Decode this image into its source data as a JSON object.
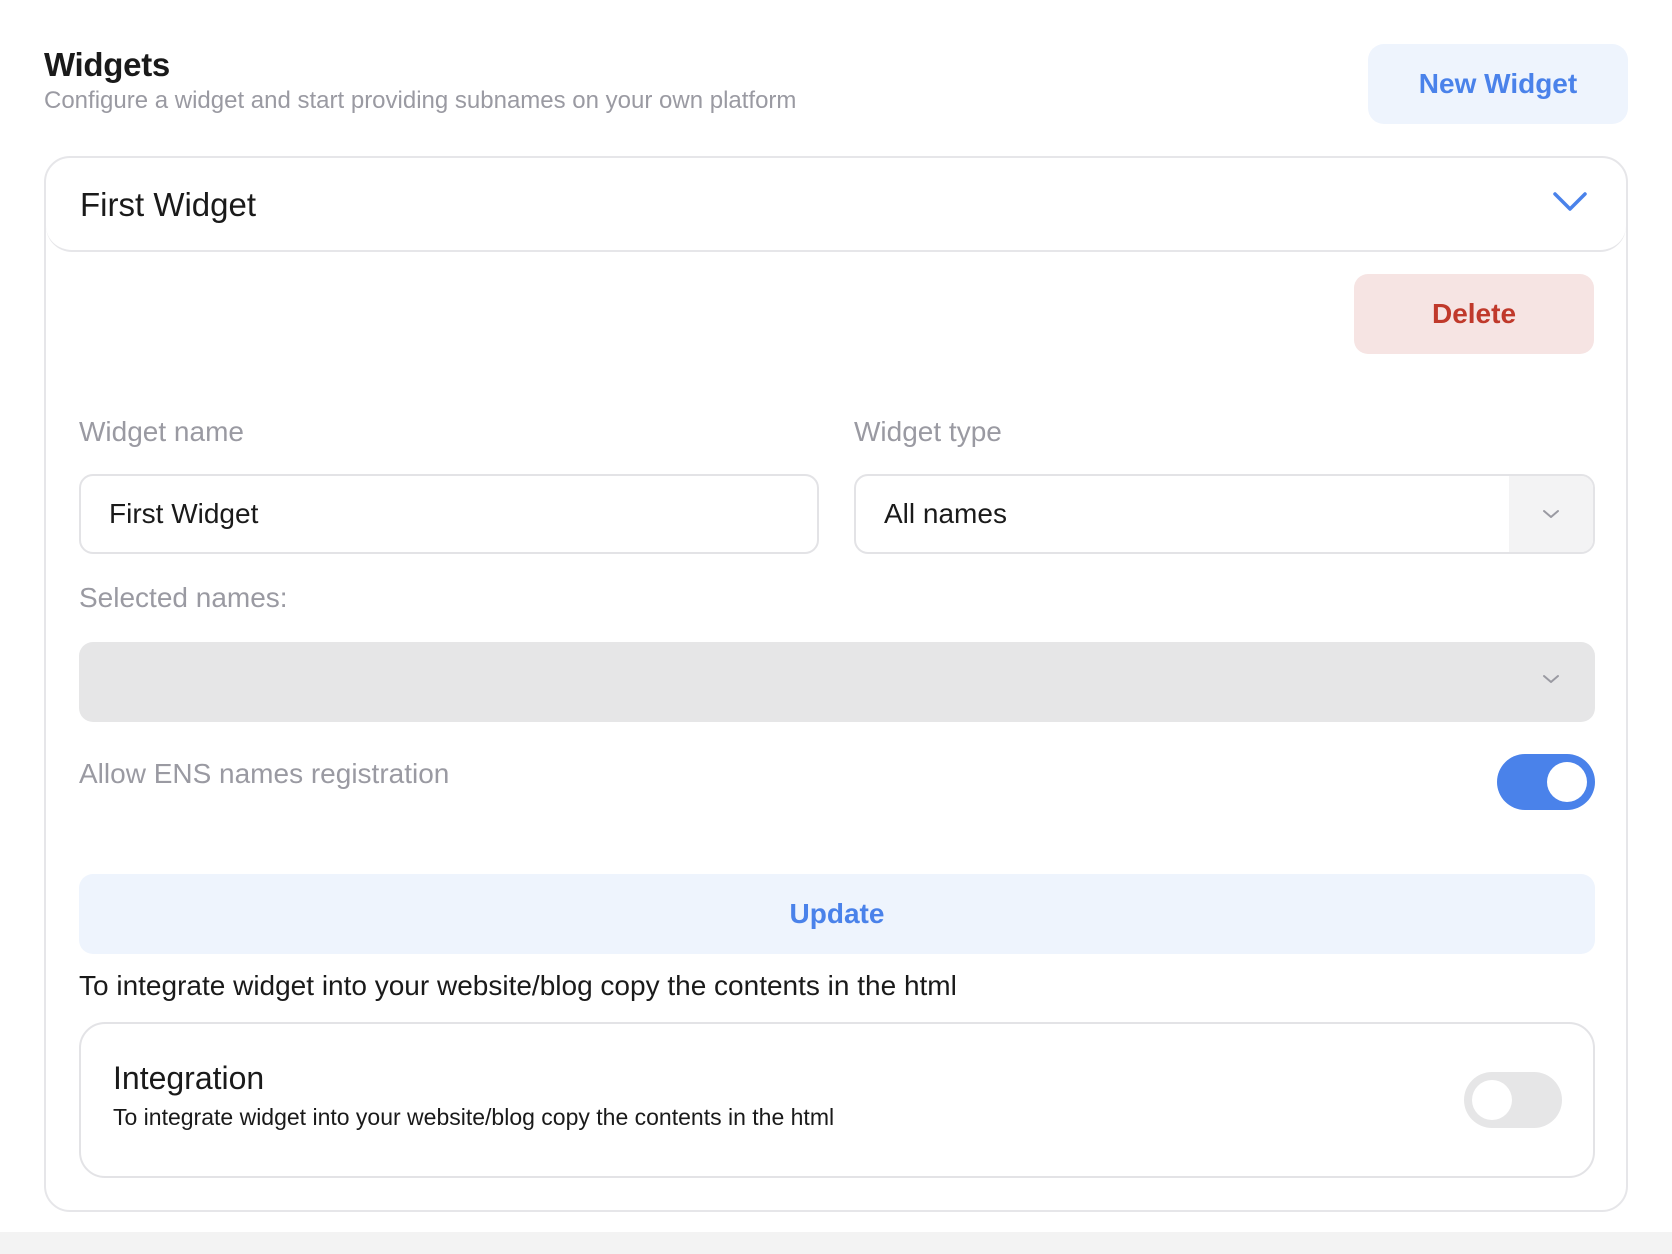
{
  "header": {
    "title": "Widgets",
    "subtitle": "Configure a widget and start providing subnames on your own platform",
    "new_widget_label": "New Widget"
  },
  "widget_card": {
    "title": "First Widget",
    "expanded_icon": "chevron-down-icon",
    "delete_label": "Delete",
    "form": {
      "name_label": "Widget name",
      "name_value": "First Widget",
      "type_label": "Widget type",
      "type_value": "All names",
      "selected_names_label": "Selected names:",
      "selected_names_value": "",
      "allow_ens_label": "Allow ENS names registration",
      "allow_ens_enabled": true
    },
    "update_label": "Update",
    "integrate_note": "To integrate widget into your website/blog copy the contents in the html",
    "integration": {
      "title": "Integration",
      "description": "To integrate widget into your website/blog copy the contents in the html",
      "enabled": false
    }
  },
  "colors": {
    "accent": "#4a82ea",
    "accent_bg": "#eef4fd",
    "danger": "#c0392b",
    "danger_bg": "#f6e4e3",
    "muted_text": "#9a9aa2",
    "toggle_off": "#e6e6e7"
  }
}
